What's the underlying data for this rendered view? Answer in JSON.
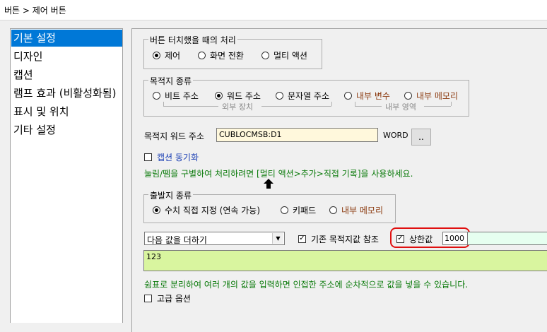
{
  "window": {
    "title": "버튼 > 제어 버튼"
  },
  "sidebar": {
    "items": [
      {
        "label": "기본 설정",
        "selected": true
      },
      {
        "label": "디자인"
      },
      {
        "label": "캡션"
      },
      {
        "label": "램프 효과 (비활성화됨)"
      },
      {
        "label": "표시 및 위치"
      },
      {
        "label": "기타 설정"
      }
    ]
  },
  "touch": {
    "legend": "버튼 터치했을 때의 처리",
    "options": [
      "제어",
      "화면 전환",
      "멀티 액션"
    ],
    "selected": 0
  },
  "target": {
    "legend": "목적지 종류",
    "options": [
      "비트 주소",
      "워드 주소",
      "문자열 주소",
      "내부 변수",
      "내부 메모리"
    ],
    "selected": 1,
    "external_label": "외부 장치",
    "internal_label": "내부 영역"
  },
  "address": {
    "label": "목적지 워드 주소",
    "value": "CUBLOCMSB:D1",
    "unit": "WORD",
    "browse_label": ".."
  },
  "caption_sync": {
    "label": "캡션 동기화",
    "checked": false
  },
  "hint_multi": "눌림/뗌을 구별하여 처리하려면 [멀티 액션>추가>직접 기록]을 사용하세요.",
  "source": {
    "legend": "출발지 종류",
    "options": [
      "수치 직접 지정 (연속 가능)",
      "키패드",
      "내부 메모리"
    ],
    "selected": 0
  },
  "operation": {
    "value": "다음 값을 더하기",
    "ref_label": "기존 목적지값 참조",
    "ref_checked": true,
    "upper_label": "상한값",
    "upper_checked": true,
    "upper_value": "1000"
  },
  "values_input": "123",
  "hint_values": "쉼표로 분리하여 여러 개의 값을 입력하면 인접한 주소에 순차적으로 값을 넣을 수 있습니다.",
  "advanced": {
    "label": "고급 옵션",
    "checked": false
  },
  "colors": {
    "selection": "#0078d7",
    "address_bg": "#fff8dc",
    "values_bg": "#d9f59f",
    "upper_bg": "#e6fff0",
    "highlight": "#e01010"
  }
}
